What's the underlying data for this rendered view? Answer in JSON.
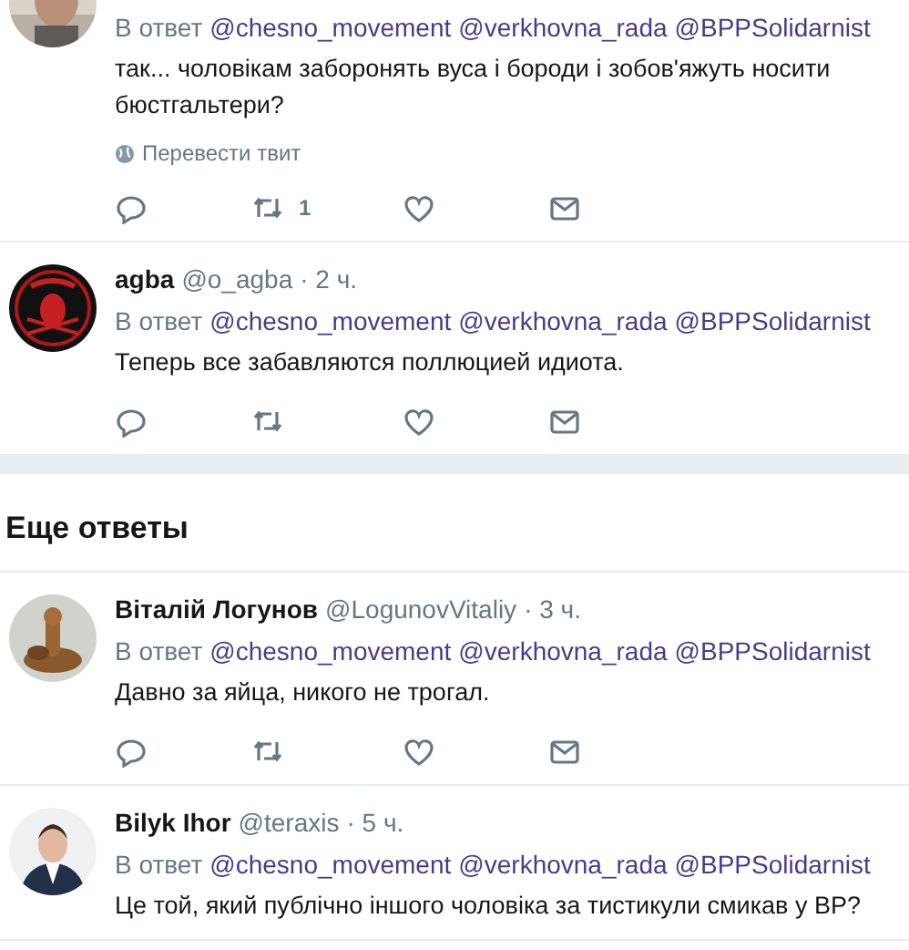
{
  "tweets": [
    {
      "reply_to": {
        "prefix": "В ответ",
        "mentions": [
          "@chesno_movement",
          "@verkhovna_rada",
          "@BPPSolidarnist"
        ]
      },
      "text": "так... чоловікам заборонять вуса і бороди і зобов'яжуть носити бюстгальтери?",
      "translate": "Перевести твит",
      "actions": [
        {
          "kind": "reply"
        },
        {
          "kind": "retweet",
          "count": "1"
        },
        {
          "kind": "like"
        },
        {
          "kind": "dm"
        }
      ]
    },
    {
      "name": "agba",
      "handle": "@o_agba",
      "time": "· 2 ч.",
      "reply_to": {
        "prefix": "В ответ",
        "mentions": [
          "@chesno_movement",
          "@verkhovna_rada",
          "@BPPSolidarnist"
        ]
      },
      "text": "Теперь все забавляются поллюцией идиота.",
      "actions": [
        {
          "kind": "reply"
        },
        {
          "kind": "retweet"
        },
        {
          "kind": "like"
        },
        {
          "kind": "dm"
        }
      ]
    }
  ],
  "more_replies": {
    "title": "Еще ответы",
    "tweets": [
      {
        "name": "Віталій Логунов",
        "handle": "@LogunovVitaliy",
        "time": "· 3 ч.",
        "reply_to": {
          "prefix": "В ответ",
          "mentions": [
            "@chesno_movement",
            "@verkhovna_rada",
            "@BPPSolidarnist"
          ]
        },
        "text": "Давно за яйца, никого не трогал.",
        "actions": [
          {
            "kind": "reply"
          },
          {
            "kind": "retweet"
          },
          {
            "kind": "like"
          },
          {
            "kind": "dm"
          }
        ]
      },
      {
        "name": "Bilyk Ihor",
        "handle": "@teraxis",
        "time": "· 5 ч.",
        "reply_to": {
          "prefix": "В ответ",
          "mentions": [
            "@chesno_movement",
            "@verkhovna_rada",
            "@BPPSolidarnist"
          ]
        },
        "text": "Це той, який публічно іншого чоловіка за тистикули смикав у ВР?"
      }
    ]
  }
}
